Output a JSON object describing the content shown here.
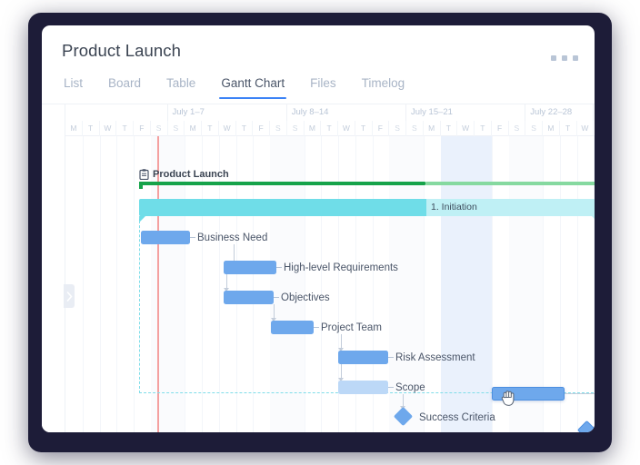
{
  "window": {
    "title": "Product Launch",
    "kebab_icon": "more-horizontal-icon"
  },
  "tabs": [
    {
      "label": "List",
      "active": false
    },
    {
      "label": "Board",
      "active": false
    },
    {
      "label": "Table",
      "active": false
    },
    {
      "label": "Gantt Chart",
      "active": true
    },
    {
      "label": "Files",
      "active": false
    },
    {
      "label": "Timelog",
      "active": false
    }
  ],
  "gantt": {
    "panel_handle_icon": "chevron-right-icon",
    "project_icon": "clipboard-icon",
    "weeks": [
      {
        "label": ""
      },
      {
        "label": "July 1–7"
      },
      {
        "label": "July 8–14"
      },
      {
        "label": "July 15–21"
      },
      {
        "label": "July 22–28"
      }
    ],
    "day_letters": [
      "M",
      "T",
      "W",
      "T",
      "F",
      "S",
      "S",
      "M",
      "T",
      "W",
      "T",
      "F",
      "S",
      "S",
      "M",
      "T",
      "W",
      "T",
      "F",
      "S",
      "S",
      "M",
      "T",
      "W",
      "T",
      "F",
      "S",
      "S",
      "M",
      "T",
      "W"
    ],
    "today_marker": "today-line",
    "rows": [
      {
        "name": "Product Launch",
        "type": "project",
        "progress_pct": 62
      },
      {
        "name": "1. Initiation",
        "type": "summary",
        "progress_pct": 62
      },
      {
        "name": "Business Need",
        "type": "task",
        "progress_pct": 100
      },
      {
        "name": "High-level Requirements",
        "type": "task",
        "progress_pct": 100
      },
      {
        "name": "Objectives",
        "type": "task",
        "progress_pct": 100
      },
      {
        "name": "Project Team",
        "type": "task",
        "progress_pct": 100
      },
      {
        "name": "Risk Assessment",
        "type": "task",
        "progress_pct": 100
      },
      {
        "name": "Scope",
        "type": "task",
        "progress_pct": 0
      },
      {
        "name": "Success Criteria",
        "type": "milestone",
        "progress_pct": 0
      },
      {
        "name": "",
        "type": "task-dragging",
        "progress_pct": 100
      },
      {
        "name": "",
        "type": "milestone",
        "progress_pct": 0
      }
    ],
    "colors": {
      "project_done": "#16a34a",
      "project_remaining": "#86d9a0",
      "summary_done": "#6fdde8",
      "summary_remaining": "#bff0f5",
      "task_done": "#6ea8ec",
      "task_remaining": "#bcd8f7",
      "today_line": "#f4a0a0",
      "accent": "#3b82f6"
    },
    "cursor": "grabbing-hand-cursor"
  }
}
